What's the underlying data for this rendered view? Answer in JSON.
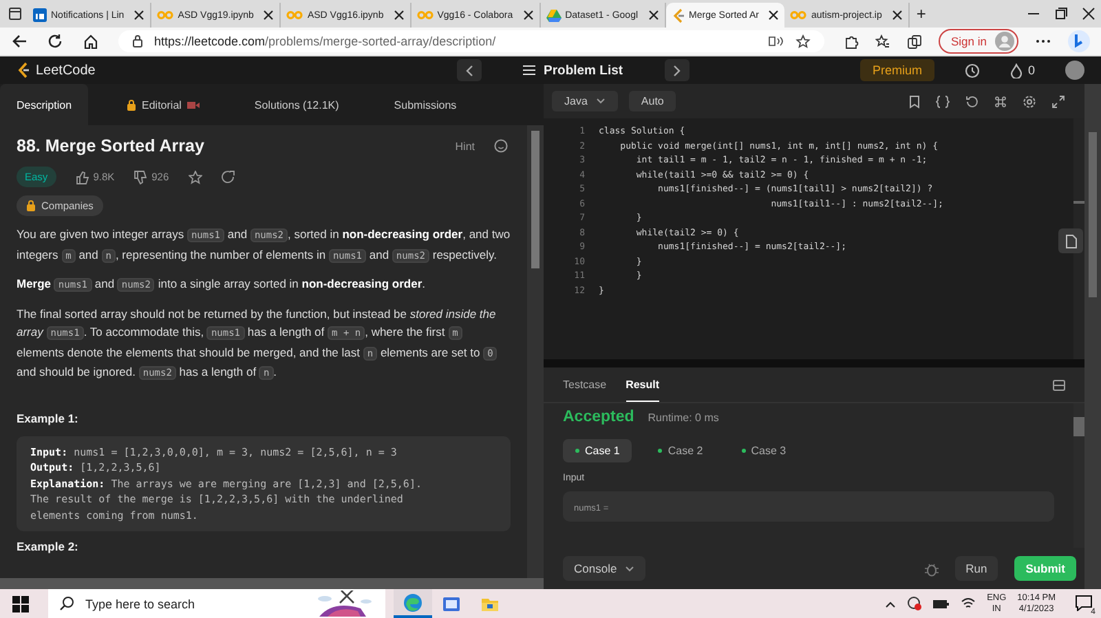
{
  "browser": {
    "tabs": [
      {
        "title": "Notifications | Lin",
        "selected": false
      },
      {
        "title": "ASD Vgg19.ipynb",
        "selected": false
      },
      {
        "title": "ASD Vgg16.ipynb",
        "selected": false
      },
      {
        "title": "Vgg16 - Colabora",
        "selected": false
      },
      {
        "title": "Dataset1 - Googl",
        "selected": false
      },
      {
        "title": "Merge Sorted Ar",
        "selected": true
      },
      {
        "title": "autism-project.ip",
        "selected": false
      }
    ],
    "new_tab": "+",
    "url_host": "https://leetcode.com",
    "url_path": "/problems/merge-sorted-array/description/",
    "sign_in": "Sign in"
  },
  "header": {
    "logo": "LeetCode",
    "problem_list": "Problem List",
    "premium": "Premium",
    "streak": "0"
  },
  "left_tabs": [
    {
      "label": "Description",
      "selected": true
    },
    {
      "label": "Editorial",
      "selected": false
    },
    {
      "label": "Solutions (12.1K)",
      "selected": false
    },
    {
      "label": "Submissions",
      "selected": false
    }
  ],
  "problem": {
    "title": "88. Merge Sorted Array",
    "hint": "Hint",
    "difficulty": "Easy",
    "likes": "9.8K",
    "dislikes": "926",
    "companies": "Companies",
    "paragraphs": [
      [
        {
          "kind": "text",
          "text": "You are given two integer arrays "
        },
        {
          "kind": "code",
          "text": "nums1"
        },
        {
          "kind": "text",
          "text": " and "
        },
        {
          "kind": "code",
          "text": "nums2"
        },
        {
          "kind": "text",
          "text": ", sorted in **non-decreasing order**, and two integers "
        },
        {
          "kind": "code",
          "text": "m"
        },
        {
          "kind": "text",
          "text": " and "
        },
        {
          "kind": "code",
          "text": "n"
        },
        {
          "kind": "text",
          "text": ", representing the number of elements in "
        },
        {
          "kind": "code",
          "text": "nums1"
        },
        {
          "kind": "text",
          "text": " and "
        },
        {
          "kind": "code",
          "text": "nums2"
        },
        {
          "kind": "text",
          "text": " respectively."
        }
      ],
      [
        {
          "kind": "text",
          "text": "**Merge** "
        },
        {
          "kind": "code",
          "text": "nums1"
        },
        {
          "kind": "text",
          "text": " and "
        },
        {
          "kind": "code",
          "text": "nums2"
        },
        {
          "kind": "text",
          "text": " into a single array sorted in **non-decreasing order**."
        }
      ],
      [
        {
          "kind": "text",
          "text": "The final sorted array should not be returned by the function, but instead be *stored inside the array* "
        },
        {
          "kind": "code",
          "text": "nums1"
        },
        {
          "kind": "text",
          "text": ". To accommodate this, "
        },
        {
          "kind": "code",
          "text": "nums1"
        },
        {
          "kind": "text",
          "text": " has a length of "
        },
        {
          "kind": "code",
          "text": "m + n"
        },
        {
          "kind": "text",
          "text": ", where the first "
        },
        {
          "kind": "code",
          "text": "m"
        },
        {
          "kind": "text",
          "text": " elements denote the elements that should be merged, and the last "
        },
        {
          "kind": "code",
          "text": "n"
        },
        {
          "kind": "text",
          "text": " elements are set to "
        },
        {
          "kind": "code",
          "text": "0"
        },
        {
          "kind": "text",
          "text": " and should be ignored. "
        },
        {
          "kind": "code",
          "text": "nums2"
        },
        {
          "kind": "text",
          "text": " has a length of "
        },
        {
          "kind": "code",
          "text": "n"
        },
        {
          "kind": "text",
          "text": "."
        }
      ]
    ],
    "example_title": "Example 1:",
    "example_lines": [
      "**Input:** nums1 = [1,2,3,0,0,0], m = 3, nums2 = [2,5,6], n = 3",
      "**Output:** [1,2,2,3,5,6]",
      "**Explanation:** The arrays we are merging are [1,2,3] and [2,5,6].",
      "The result of the merge is [1,2,2,3,5,6] with the underlined",
      "elements coming from nums1."
    ],
    "next_title": "Example 2:"
  },
  "editor": {
    "language": "Java",
    "mode": "Auto",
    "lines": [
      {
        "number": "1",
        "text": "class Solution {"
      },
      {
        "number": "2",
        "text": "    public void merge(int[] nums1, int m, int[] nums2, int n) {"
      },
      {
        "number": "3",
        "text": "       int tail1 = m - 1, tail2 = n - 1, finished = m + n -1;"
      },
      {
        "number": "4",
        "text": "       while(tail1 >=0 && tail2 >= 0) {"
      },
      {
        "number": "5",
        "text": "           nums1[finished--] = (nums1[tail1] > nums2[tail2]) ?"
      },
      {
        "number": "6",
        "text": "                                nums1[tail1--] : nums2[tail2--];"
      },
      {
        "number": "7",
        "text": "       }"
      },
      {
        "number": "8",
        "text": "       while(tail2 >= 0) {"
      },
      {
        "number": "9",
        "text": "           nums1[finished--] = nums2[tail2--];"
      },
      {
        "number": "10",
        "text": "       }"
      },
      {
        "number": "11",
        "text": "       }"
      },
      {
        "number": "12",
        "text": "}"
      }
    ]
  },
  "console": {
    "tabs": [
      {
        "label": "Testcase",
        "selected": false
      },
      {
        "label": "Result",
        "selected": true
      }
    ],
    "verdict": "Accepted",
    "runtime": "Runtime: 0 ms",
    "cases": [
      {
        "label": "Case 1",
        "selected": true
      },
      {
        "label": "Case 2",
        "selected": false
      },
      {
        "label": "Case 3",
        "selected": false
      }
    ],
    "input_label": "Input",
    "input_var": "nums1 =",
    "console_button": "Console",
    "run": "Run",
    "submit": "Submit"
  },
  "taskbar": {
    "search_placeholder": "Type here to search",
    "language": "ENG",
    "region": "IN",
    "time": "10:14 PM",
    "date": "4/1/2023",
    "notifications": "4"
  }
}
